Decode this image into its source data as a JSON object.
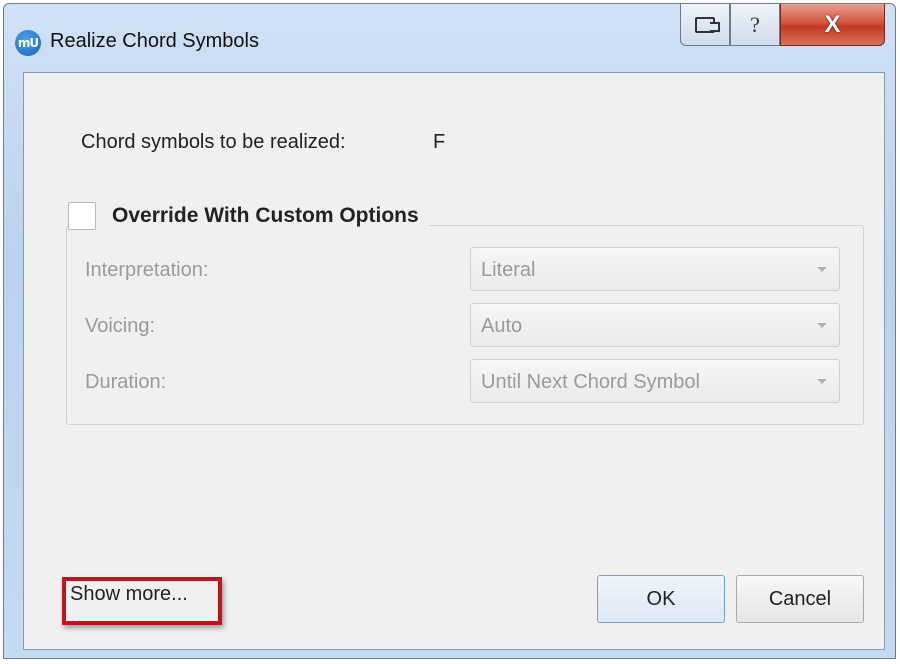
{
  "window": {
    "title": "Realize Chord Symbols",
    "app_icon": "mu-logo-icon",
    "caption_buttons": {
      "context": "context-help-icon",
      "help": "?",
      "close": "X"
    }
  },
  "info": {
    "label": "Chord symbols to be realized:",
    "value": "F"
  },
  "custom_options": {
    "checkbox_label": "Override With Custom Options",
    "checked": false,
    "rows": [
      {
        "label": "Interpretation:",
        "value": "Literal"
      },
      {
        "label": "Voicing:",
        "value": "Auto"
      },
      {
        "label": "Duration:",
        "value": "Until Next Chord Symbol"
      }
    ]
  },
  "footer": {
    "show_more": "Show more...",
    "ok": "OK",
    "cancel": "Cancel"
  },
  "colors": {
    "highlight": "#c0141c",
    "close_button": "#c33a22",
    "disabled_text": "#9a9a9a"
  }
}
